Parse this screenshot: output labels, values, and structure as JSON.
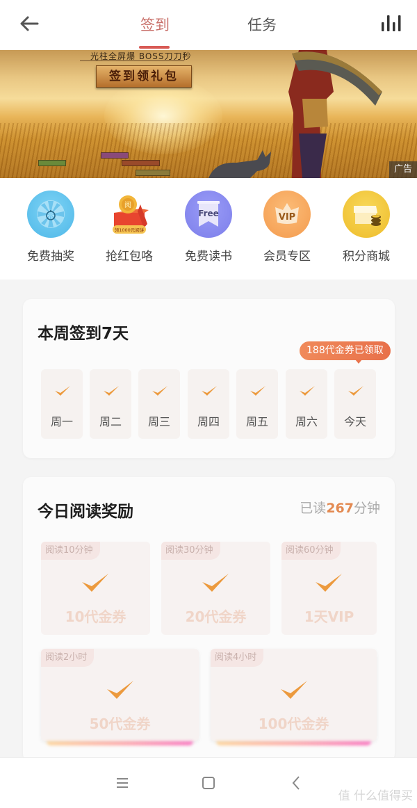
{
  "topbar": {
    "back_icon": "arrow-left-icon",
    "tabs": [
      {
        "label": "签到",
        "active": true
      },
      {
        "label": "任务",
        "active": false
      }
    ],
    "stats_icon": "bar-chart-icon",
    "accent_color": "#d85a55"
  },
  "banner": {
    "tagline": "光柱全屏爆 BOSS刀刀秒",
    "button_label": "签到领礼包",
    "ad_label": "广告"
  },
  "quick_entries": [
    {
      "label": "免费抽奖",
      "icon": "lottery-wheel-icon",
      "color": "#5cc3ef"
    },
    {
      "label": "抢红包咯",
      "icon": "red-packet-icon",
      "badge": "领1000元阅饼",
      "color": "#f0a23a"
    },
    {
      "label": "免费读书",
      "icon": "free-book-icon",
      "icon_text": "Free",
      "color": "#8a8cf2"
    },
    {
      "label": "会员专区",
      "icon": "vip-crown-icon",
      "icon_text": "VIP",
      "color": "#f6a860"
    },
    {
      "label": "积分商城",
      "icon": "shop-coins-icon",
      "color": "#f3c73a"
    }
  ],
  "week_signin": {
    "title": "本周签到7天",
    "bubble": "188代金券已领取",
    "days": [
      {
        "label": "周一",
        "checked": true
      },
      {
        "label": "周二",
        "checked": true
      },
      {
        "label": "周三",
        "checked": true
      },
      {
        "label": "周四",
        "checked": true
      },
      {
        "label": "周五",
        "checked": true
      },
      {
        "label": "周六",
        "checked": true
      },
      {
        "label": "今天",
        "checked": true
      }
    ],
    "check_color": "#ec9a3e"
  },
  "reading_reward": {
    "title": "今日阅读奖励",
    "stat_prefix": "已读",
    "stat_value": "267",
    "stat_suffix": "分钟",
    "rewards": [
      {
        "tag": "阅读10分钟",
        "amount": "10代金券",
        "claimed": true
      },
      {
        "tag": "阅读30分钟",
        "amount": "20代金券",
        "claimed": true
      },
      {
        "tag": "阅读60分钟",
        "amount": "1天VIP",
        "claimed": true
      },
      {
        "tag": "阅读2小时",
        "amount": "50代金券",
        "claimed": true
      },
      {
        "tag": "阅读4小时",
        "amount": "100代金券",
        "claimed": true
      }
    ]
  },
  "navbar": {
    "menu_icon": "menu-icon",
    "home_icon": "home-square-icon",
    "back_icon": "chevron-left-icon",
    "watermark": "值 什么值得买"
  }
}
